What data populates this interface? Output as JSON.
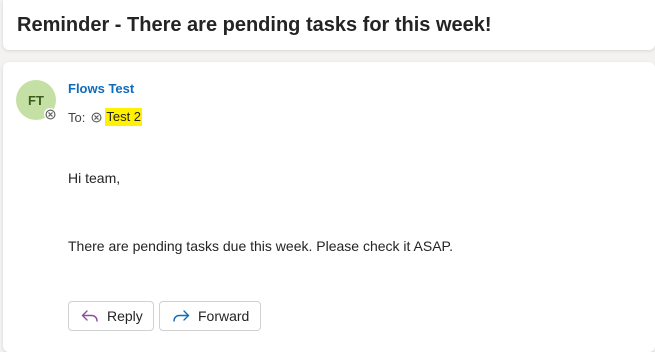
{
  "subject": {
    "title": "Reminder - There are pending tasks for this week!"
  },
  "message": {
    "avatar_initials": "FT",
    "avatar_color": "#c5e0a5",
    "sender_name": "Flows Test",
    "sender_color": "#0f6cbd",
    "to_label": "To:",
    "recipient": "Test 2",
    "recipient_highlight": "#fff100",
    "body": {
      "greeting": "Hi team,",
      "line": "There are pending tasks due this week. Please check it ASAP."
    }
  },
  "actions": {
    "reply_label": "Reply",
    "reply_icon": "reply-arrow-icon",
    "forward_label": "Forward",
    "forward_icon": "forward-arrow-icon"
  }
}
